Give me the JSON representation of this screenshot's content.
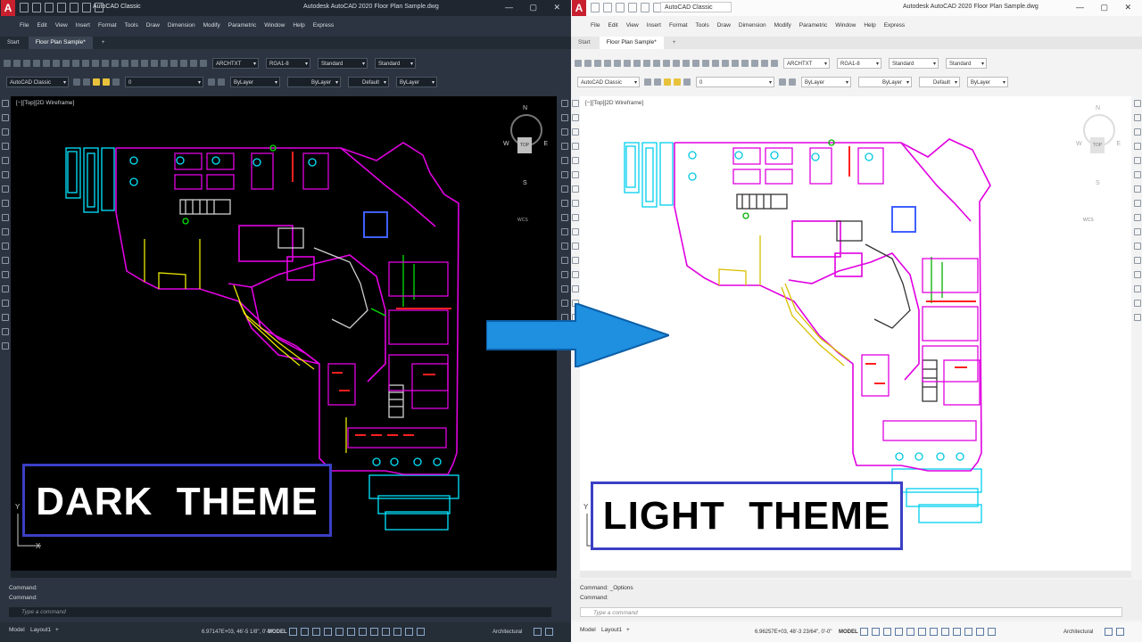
{
  "windows": [
    {
      "theme": "dark",
      "app_logo": "A",
      "workspace": "AutoCAD Classic",
      "title": "Autodesk AutoCAD 2020   Floor Plan Sample.dwg",
      "window_controls": "— ▢ ✕",
      "menu": [
        "File",
        "Edit",
        "View",
        "Insert",
        "Format",
        "Tools",
        "Draw",
        "Dimension",
        "Modify",
        "Parametric",
        "Window",
        "Help",
        "Express"
      ],
      "tabs": [
        "Start",
        "Floor Plan Sample*",
        "+"
      ],
      "toolbar1": {
        "text_style": "ARCHTXT",
        "dim_style": "RGA1-8",
        "table_style": "Standard",
        "mleader_style": "Standard"
      },
      "toolbar2": {
        "workspace": "AutoCAD Classic",
        "layer": "0",
        "color": "ByLayer",
        "linetype": "ByLayer",
        "lineweight": "Default",
        "plotstyle": "ByLayer"
      },
      "viewport_label": "[−][Top][2D Wireframe]",
      "viewcube": {
        "n": "N",
        "s": "S",
        "e": "E",
        "w": "W",
        "face": "TOP",
        "wcs": "WCS"
      },
      "command_history": [
        "Command:",
        "Command:"
      ],
      "command_placeholder": "Type a command",
      "status": {
        "model_tab": "Model",
        "layout_tab": "Layout1",
        "add": "+",
        "coords": "6.97147E+03, 46'-5 1/8\", 0'-0\"",
        "model": "MODEL",
        "annotation": "Architectural"
      },
      "ucs": {
        "x": "X",
        "y": "Y"
      }
    },
    {
      "theme": "light",
      "app_logo": "A",
      "workspace": "AutoCAD Classic",
      "title": "Autodesk AutoCAD 2020   Floor Plan Sample.dwg",
      "window_controls": "— ▢ ✕",
      "menu": [
        "File",
        "Edit",
        "View",
        "Insert",
        "Format",
        "Tools",
        "Draw",
        "Dimension",
        "Modify",
        "Parametric",
        "Window",
        "Help",
        "Express"
      ],
      "tabs": [
        "Start",
        "Floor Plan Sample*",
        "+"
      ],
      "toolbar1": {
        "text_style": "ARCHTXT",
        "dim_style": "RGA1-8",
        "table_style": "Standard",
        "mleader_style": "Standard"
      },
      "toolbar2": {
        "workspace": "AutoCAD Classic",
        "layer": "0",
        "color": "ByLayer",
        "linetype": "ByLayer",
        "lineweight": "Default",
        "plotstyle": "ByLayer"
      },
      "viewport_label": "[−][Top][2D Wireframe]",
      "viewcube": {
        "n": "N",
        "s": "S",
        "e": "E",
        "w": "W",
        "face": "TOP",
        "wcs": "WCS"
      },
      "command_history": [
        "Command: _Options",
        "Command:"
      ],
      "command_placeholder": "Type a command",
      "status": {
        "model_tab": "Model",
        "layout_tab": "Layout1",
        "add": "+",
        "coords": "6.96257E+03, 48'-3 23/64\", 0'-0\"",
        "model": "MODEL",
        "annotation": "Architectural"
      },
      "ucs": {
        "x": "X",
        "y": "Y"
      }
    }
  ],
  "labels": {
    "dark": "DARK  THEME",
    "light": "LIGHT  THEME"
  },
  "colors": {
    "accent_arrow": "#1f8fe0",
    "label_border": "#3b3fc4",
    "cad_cyan": "#00e5ff",
    "cad_magenta": "#e000e0",
    "cad_yellow": "#e8e800",
    "cad_green": "#00e000",
    "cad_red": "#ff2020",
    "cad_white_dark": "#ffffff",
    "cad_white_light": "#000000"
  }
}
